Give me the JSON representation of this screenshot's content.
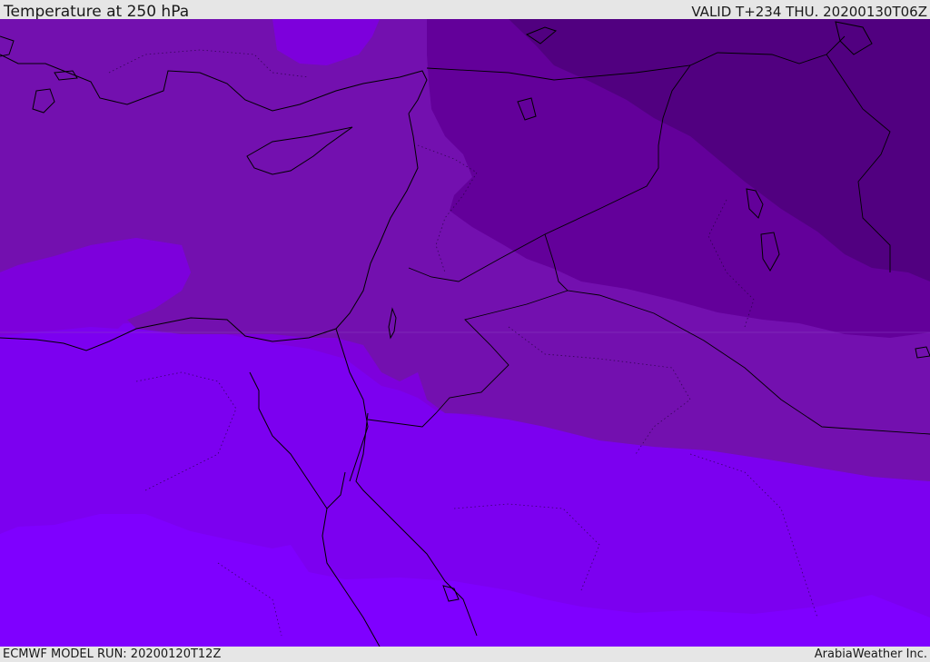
{
  "header": {
    "title": "Temperature at 250 hPa",
    "valid": "VALID T+234 THU. 20200130T06Z"
  },
  "footer": {
    "model_run": "ECMWF MODEL RUN: 20200120T12Z",
    "credit": "ArabiaWeather Inc."
  },
  "map": {
    "field": "Temperature at 250 hPa",
    "colors": {
      "darkest": "#510080",
      "dark": "#63009a",
      "mid": "#7310af",
      "light": "#7d00dc",
      "lighter": "#7c00f0",
      "lightest": "#7f00ff",
      "coast": "#000000"
    }
  }
}
